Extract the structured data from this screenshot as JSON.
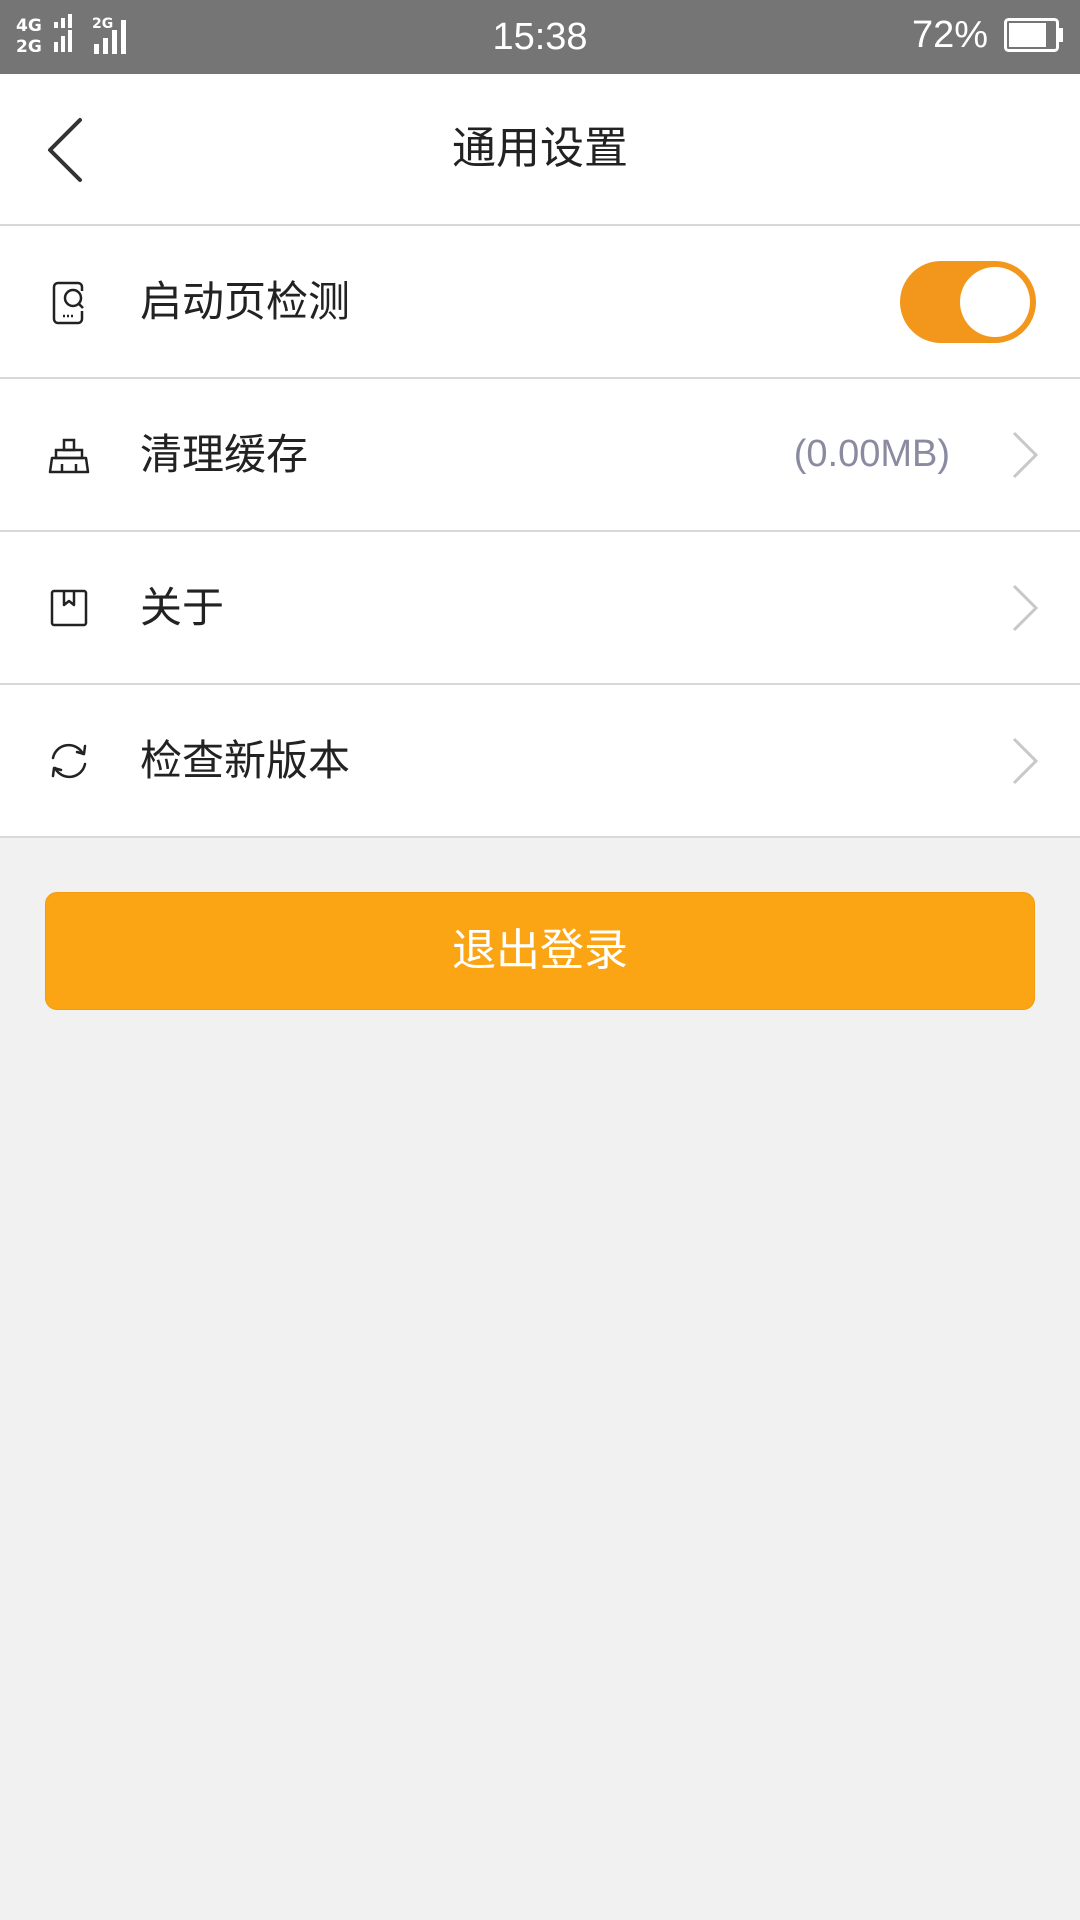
{
  "status_bar": {
    "network_1": "4G",
    "network_2": "2G",
    "network_3": "2G",
    "time": "15:38",
    "battery": "72%"
  },
  "header": {
    "title": "通用设置",
    "back_icon": "chevron-left-icon"
  },
  "settings": [
    {
      "icon": "phone-search-icon",
      "label": "启动页检测",
      "control": "toggle",
      "toggle_on": true
    },
    {
      "icon": "broom-icon",
      "label": "清理缓存",
      "value": "(0.00MB)",
      "control": "chevron"
    },
    {
      "icon": "bookmark-icon",
      "label": "关于",
      "control": "chevron"
    },
    {
      "icon": "refresh-icon",
      "label": "检查新版本",
      "control": "chevron"
    }
  ],
  "logout": {
    "label": "退出登录"
  },
  "colors": {
    "accent": "#fca514",
    "toggle": "#f3971c",
    "status_bar": "#757575",
    "background": "#f1f1f1"
  }
}
